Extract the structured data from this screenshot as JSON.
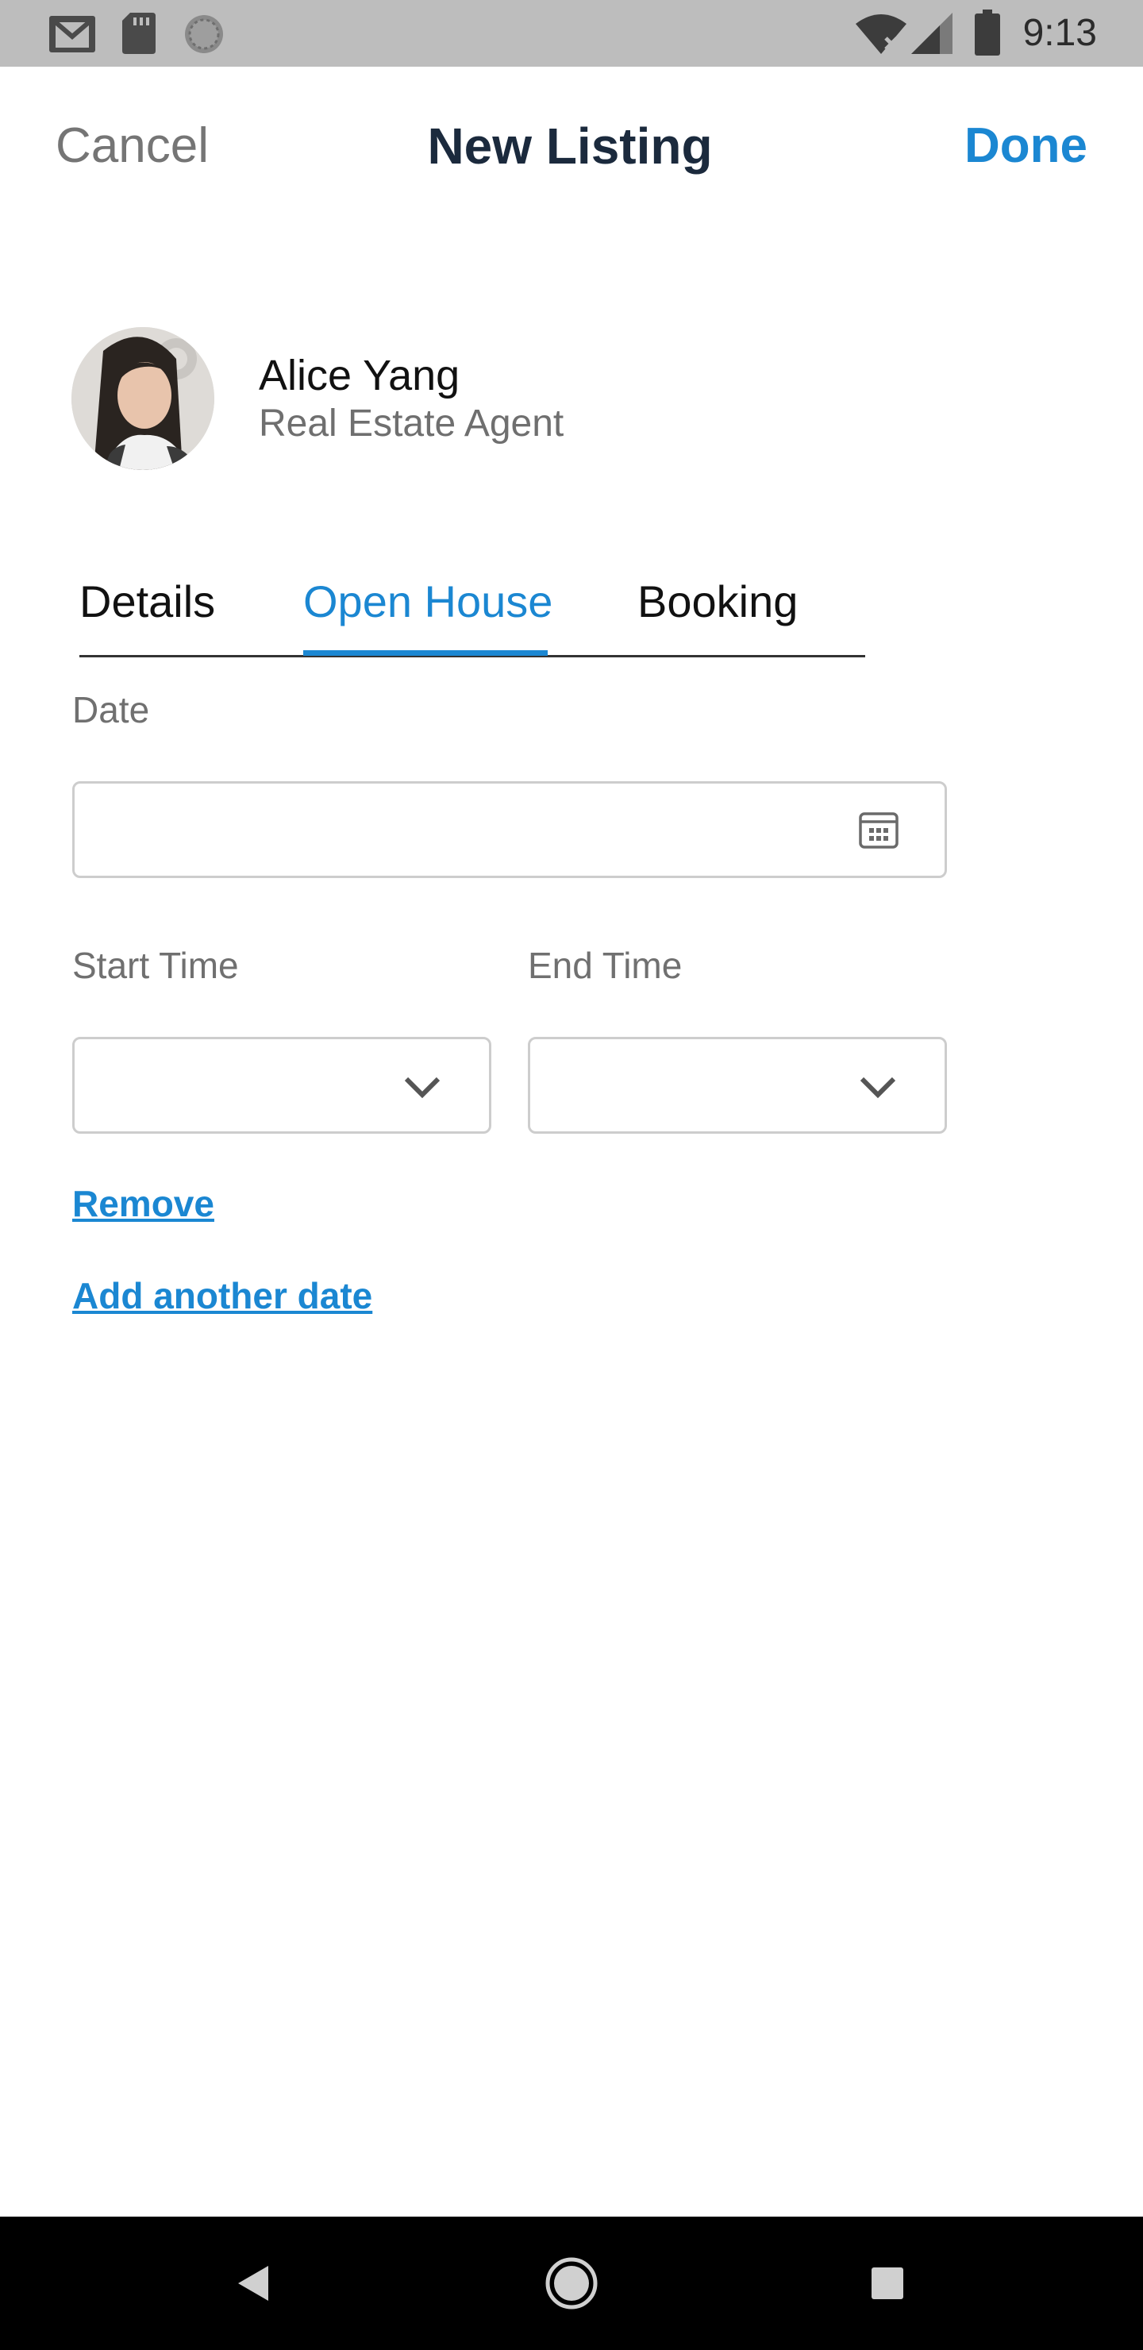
{
  "status_bar": {
    "time": "9:13",
    "icons": [
      "gmail-icon",
      "sd-card-icon",
      "sync-icon",
      "wifi-icon",
      "cellular-signal-icon",
      "battery-icon"
    ]
  },
  "header": {
    "cancel_label": "Cancel",
    "title": "New Listing",
    "done_label": "Done",
    "accent_color": "#1b87d2"
  },
  "agent": {
    "name": "Alice Yang",
    "role": "Real Estate Agent"
  },
  "tabs": [
    {
      "label": "Details",
      "active": false
    },
    {
      "label": "Open House",
      "active": true
    },
    {
      "label": "Booking",
      "active": false
    }
  ],
  "form": {
    "date_label": "Date",
    "date_value": "",
    "start_time_label": "Start Time",
    "start_time_value": "",
    "end_time_label": "End Time",
    "end_time_value": "",
    "remove_link": "Remove",
    "add_date_link": "Add another date"
  },
  "nav_bar": {
    "buttons": [
      "back-icon",
      "home-icon",
      "recents-icon"
    ]
  }
}
